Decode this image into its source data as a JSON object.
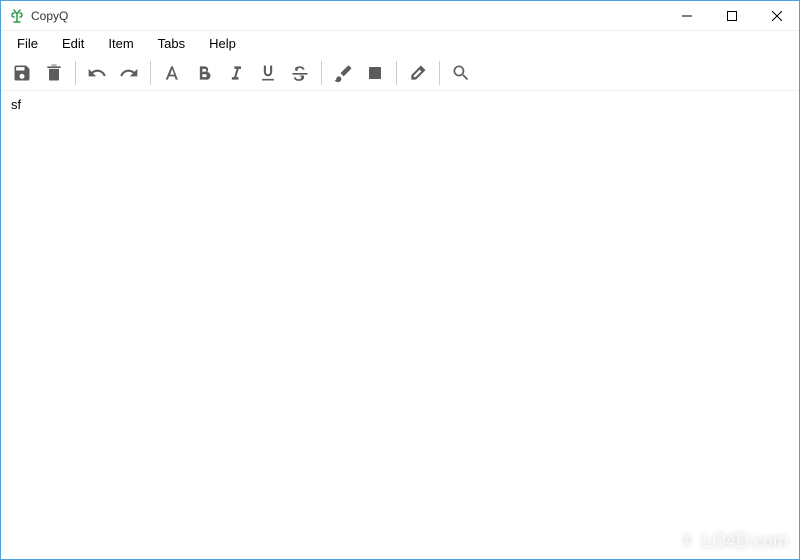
{
  "window": {
    "title": "CopyQ"
  },
  "menu": {
    "file": "File",
    "edit": "Edit",
    "item": "Item",
    "tabs": "Tabs",
    "help": "Help"
  },
  "toolbar": {
    "save": "save-icon",
    "delete": "trash-icon",
    "undo": "undo-icon",
    "redo": "redo-icon",
    "font": "font-icon",
    "bold": "bold-icon",
    "italic": "italic-icon",
    "underline": "underline-icon",
    "strikethrough": "strikethrough-icon",
    "foreground": "brush-icon",
    "background": "square-icon",
    "erase": "eraser-icon",
    "search": "search-icon"
  },
  "content": {
    "text": "sf"
  },
  "watermark": {
    "text": "LO4D.com"
  },
  "colors": {
    "iconGray": "#5c5c5c",
    "borderBlue": "#4da0e0",
    "appIconGreen": "#2e9b4f"
  }
}
